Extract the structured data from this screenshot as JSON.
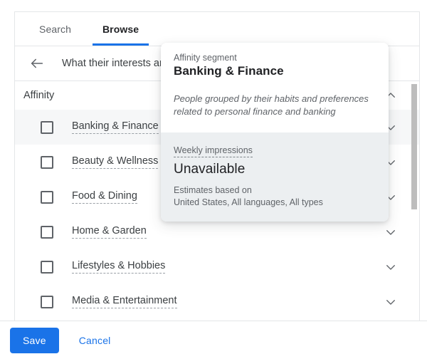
{
  "tabs": [
    {
      "label": "Search",
      "active": false
    },
    {
      "label": "Browse",
      "active": true
    }
  ],
  "breadcrumb": {
    "back_icon": "arrow-left-icon",
    "label": "What their interests and habits are"
  },
  "list": {
    "group_label": "Affinity",
    "group_chevron": "chevron-up-icon",
    "items": [
      {
        "label": "Banking & Finance",
        "checked": false,
        "selected": true,
        "chevron": "chevron-down-icon"
      },
      {
        "label": "Beauty & Wellness",
        "checked": false,
        "selected": false,
        "chevron": "chevron-down-icon"
      },
      {
        "label": "Food & Dining",
        "checked": false,
        "selected": false,
        "chevron": "chevron-down-icon"
      },
      {
        "label": "Home & Garden",
        "checked": false,
        "selected": false,
        "chevron": "chevron-down-icon"
      },
      {
        "label": "Lifestyles & Hobbies",
        "checked": false,
        "selected": false,
        "chevron": "chevron-down-icon"
      },
      {
        "label": "Media & Entertainment",
        "checked": false,
        "selected": false,
        "chevron": "chevron-down-icon"
      }
    ]
  },
  "popup": {
    "eyebrow": "Affinity segment",
    "title": "Banking & Finance",
    "description": "People grouped by their habits and preferences related to personal finance and banking",
    "metric_label": "Weekly impressions",
    "metric_value": "Unavailable",
    "estimates_line1": "Estimates based on",
    "estimates_line2": "United States, All languages, All types"
  },
  "footer": {
    "save_label": "Save",
    "cancel_label": "Cancel"
  },
  "colors": {
    "accent": "#1a73e8",
    "selected_row": "#f6f7f8",
    "popup_bottom": "#eceff1",
    "text_primary": "#202124",
    "text_secondary": "#5f6368",
    "scrollbar_thumb": "#bdbdbd"
  }
}
